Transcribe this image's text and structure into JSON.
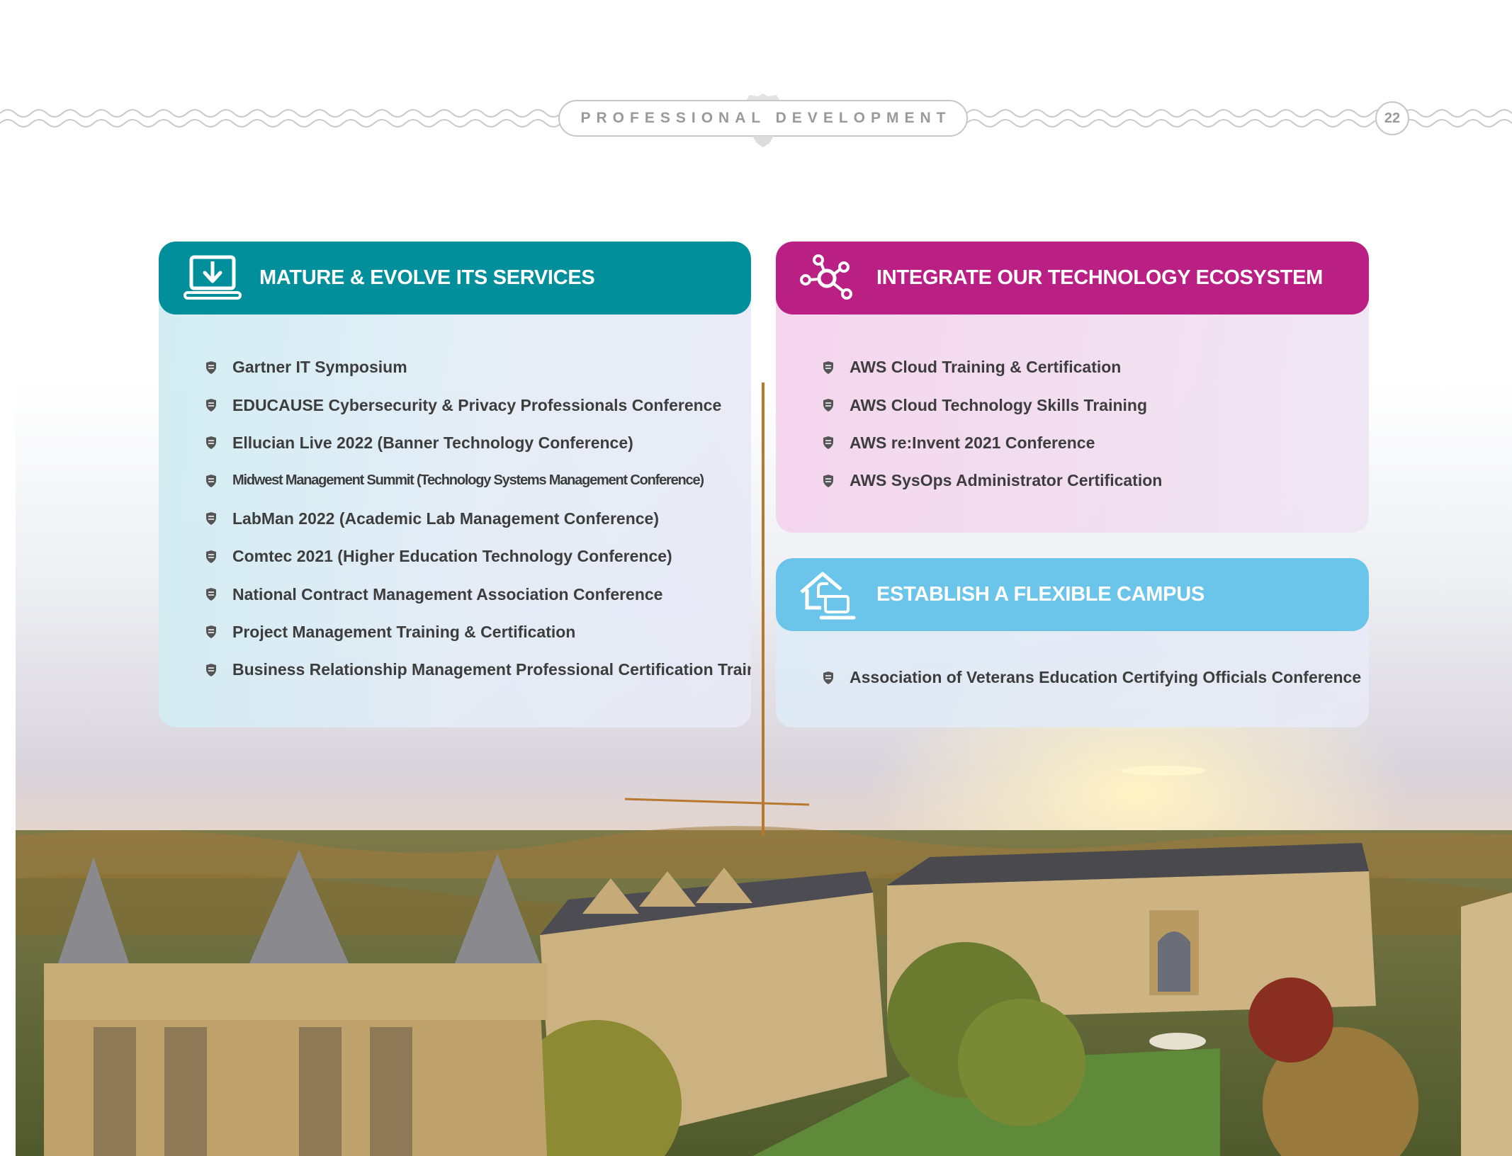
{
  "header": {
    "section_title": "PROFESSIONAL DEVELOPMENT",
    "page_number": "22"
  },
  "colors": {
    "teal": "#008f9b",
    "magenta": "#ba1f84",
    "sky_blue": "#6bc4ea",
    "text": "#3d3d3d"
  },
  "cards": {
    "mature": {
      "title": "MATURE & EVOLVE ITS SERVICES",
      "icon": "laptop-download-icon",
      "items": [
        "Gartner IT Symposium",
        "EDUCAUSE Cybersecurity & Privacy Professionals Conference",
        "Ellucian Live 2022 (Banner Technology Conference)",
        "Midwest Management Summit (Technology Systems Management Conference)",
        "LabMan 2022 (Academic Lab Management Conference)",
        "Comtec 2021 (Higher Education Technology Conference)",
        "National Contract Management Association Conference",
        "Project Management Training & Certification",
        "Business Relationship Management Professional Certification Training"
      ]
    },
    "integrate": {
      "title": "INTEGRATE OUR TECHNOLOGY ECOSYSTEM",
      "icon": "network-nodes-icon",
      "items": [
        "AWS Cloud Training & Certification",
        "AWS Cloud Technology Skills Training",
        "AWS re:Invent 2021 Conference",
        "AWS SysOps Administrator Certification"
      ]
    },
    "flexible": {
      "title": "ESTABLISH A FLEXIBLE CAMPUS",
      "icon": "home-laptop-icon",
      "items": [
        "Association of Veterans Education Certifying Officials Conference"
      ]
    }
  },
  "background": {
    "image": "campus-aerial-photo"
  }
}
